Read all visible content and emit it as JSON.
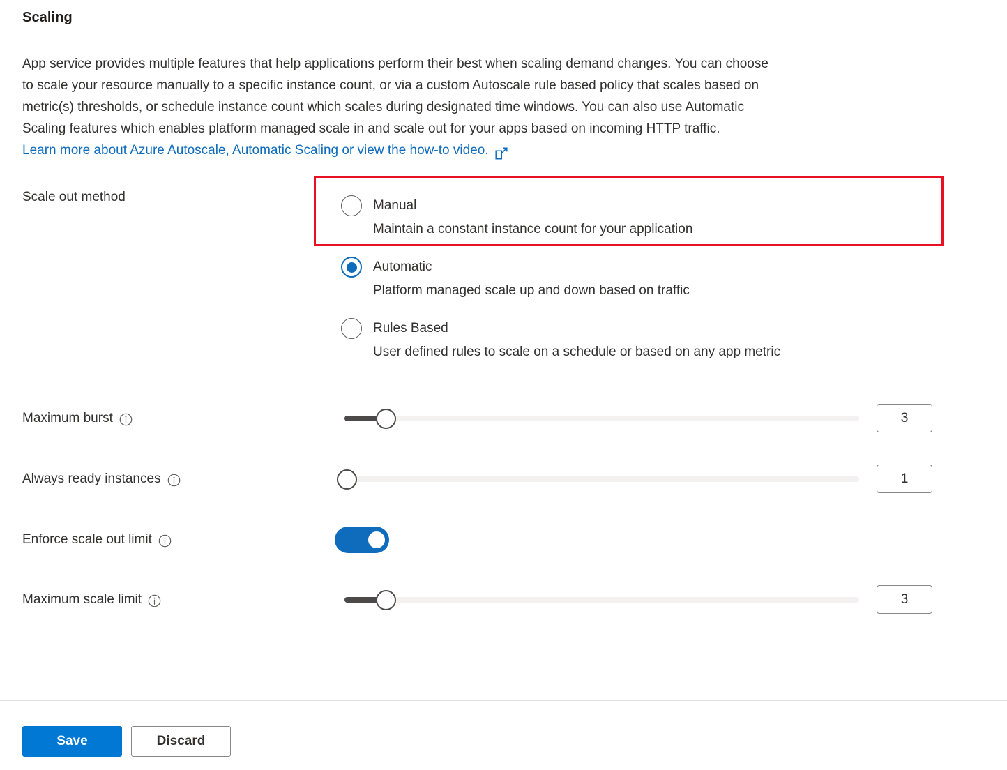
{
  "page": {
    "title": "Scaling",
    "description_lines": [
      "App service provides multiple features that help applications perform their best when scaling demand changes. You can choose",
      "to scale your resource manually to a specific instance count, or via a custom Autoscale rule based policy that scales based on",
      "metric(s) thresholds, or schedule instance count which scales during designated time windows. You can also use Automatic",
      "Scaling features which enables platform managed scale in and scale out for your apps based on incoming HTTP traffic."
    ],
    "learn_more_text": "Learn more about Azure Autoscale, Automatic Scaling or view the how-to video.",
    "external_link_icon": "external-link-icon"
  },
  "scale_out_method": {
    "label": "Scale out method",
    "highlight_color": "#e81123",
    "highlighted_option_index": 0,
    "selected_index": 1,
    "options": [
      {
        "label": "Manual",
        "description": "Maintain a constant instance count for your application",
        "checked": false
      },
      {
        "label": "Automatic",
        "description": "Platform managed scale up and down based on traffic",
        "checked": true
      },
      {
        "label": "Rules Based",
        "description": "User defined rules to scale on a schedule or based on any app metric",
        "checked": false
      }
    ]
  },
  "settings": {
    "maximum_burst": {
      "label": "Maximum burst",
      "info_icon": "info-icon",
      "value": "3",
      "slider_percent": 8
    },
    "always_ready_instances": {
      "label": "Always ready instances",
      "info_icon": "info-icon",
      "value": "1",
      "slider_percent": 0
    },
    "enforce_scale_out_limit": {
      "label": "Enforce scale out limit",
      "info_icon": "info-icon",
      "toggle_on": true,
      "toggle_color": "#0f6cbd"
    },
    "maximum_scale_limit": {
      "label": "Maximum scale limit",
      "info_icon": "info-icon",
      "value": "3",
      "slider_percent": 8
    }
  },
  "footer": {
    "save_label": "Save",
    "discard_label": "Discard",
    "primary_color": "#0078d4"
  }
}
